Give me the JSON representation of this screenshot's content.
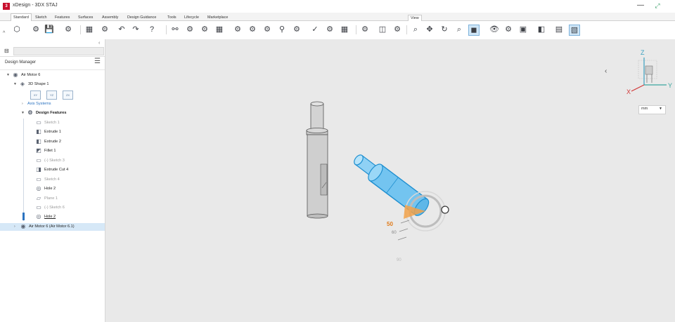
{
  "app": {
    "logo": "3",
    "title": "xDesign - 3DX STAJ"
  },
  "window": {
    "minimize": "—",
    "fullscreen": "⤢"
  },
  "tabs": [
    {
      "label": "Standard",
      "active": true
    },
    {
      "label": "Sketch"
    },
    {
      "label": "Features"
    },
    {
      "label": "Surfaces"
    },
    {
      "label": "Assembly"
    },
    {
      "label": "Design Guidance"
    },
    {
      "label": "Tools"
    },
    {
      "label": "Lifecycle"
    },
    {
      "label": "Marketplace"
    }
  ],
  "toolbar": {
    "view_label": "View"
  },
  "panel": {
    "title": "Design Manager",
    "menu_icon": "☰",
    "collapse_icon": "‹",
    "tree_icon": "⊟",
    "planes": [
      "XY",
      "YZ",
      "ZX"
    ],
    "tree": [
      {
        "label": "Air Motor 6",
        "toggle": "▼",
        "icon": "assembly-icon"
      },
      {
        "label": "3D Shape 1",
        "toggle": "▼",
        "icon": "shape-icon"
      },
      {
        "label": "Axis Systems",
        "toggle": "›",
        "icon": ""
      },
      {
        "label": "Design Features",
        "toggle": "▼",
        "icon": "features-icon"
      },
      {
        "label": "Sketch 1",
        "icon": "sketch-icon"
      },
      {
        "label": "Extrude 1",
        "icon": "extrude-icon"
      },
      {
        "label": "Extrude 2",
        "icon": "extrude-icon"
      },
      {
        "label": "Fillet 1",
        "icon": "fillet-icon"
      },
      {
        "label": "(-) Sketch 3",
        "icon": "sketch-icon"
      },
      {
        "label": "Extrude Cut 4",
        "icon": "extrude-cut-icon"
      },
      {
        "label": "Sketch 4",
        "icon": "sketch-icon"
      },
      {
        "label": "Hole 2",
        "icon": "hole-icon"
      },
      {
        "label": "Plane 1",
        "icon": "plane-icon"
      },
      {
        "label": "(-) Sketch 6",
        "icon": "sketch-icon"
      },
      {
        "label": "Hole 2",
        "icon": "hole-icon"
      },
      {
        "label": "Air Motor 6 (Air Motor 6.1)",
        "toggle": "›",
        "icon": "assembly-icon"
      }
    ]
  },
  "viewport": {
    "units": "mm",
    "units_caret": "▼",
    "nav_chevron": "‹",
    "triad": {
      "z": "Z",
      "x": "X",
      "y": "Y"
    },
    "rotation_labels": [
      "50",
      "60",
      "90"
    ]
  },
  "colors": {
    "accent": "#2b73c0",
    "highlight": "#44b6f0",
    "logo": "#c8102e"
  }
}
